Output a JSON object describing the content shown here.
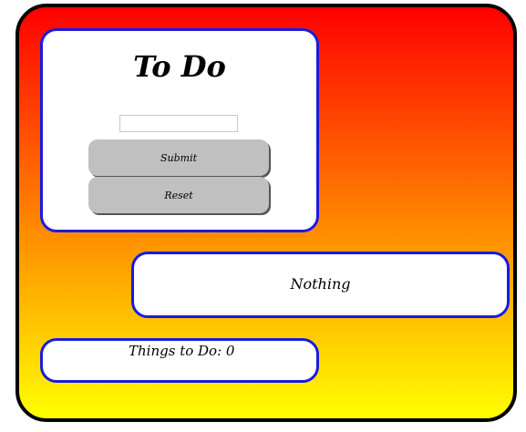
{
  "app": {
    "title": "To Do"
  },
  "form": {
    "input_value": "",
    "input_placeholder": "",
    "submit_label": "Submit",
    "reset_label": "Reset"
  },
  "message": {
    "text": "Nothing"
  },
  "counter": {
    "text": "Things to Do: 0"
  },
  "colors": {
    "panel_border": "#1a1ae0",
    "gradient_top": "#ff0000",
    "gradient_bottom": "#ffff00",
    "button_bg": "#c0c0c0"
  }
}
